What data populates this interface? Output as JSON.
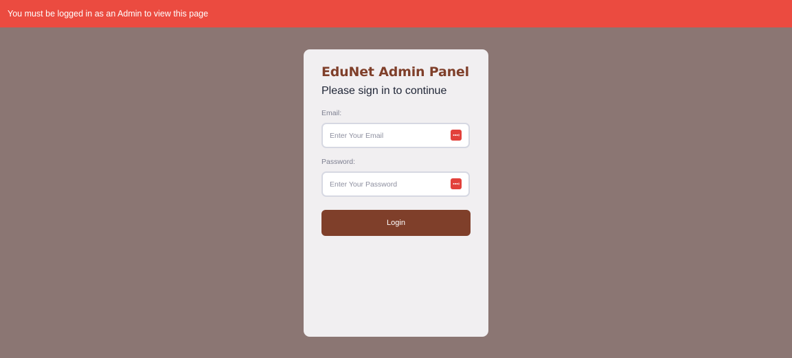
{
  "alert": {
    "message": "You must be logged in as an Admin to view this page",
    "color": "#eb4b40"
  },
  "login_card": {
    "title": "EduNet Admin Panel",
    "subtitle": "Please sign in to continue",
    "email": {
      "label": "Email:",
      "placeholder": "Enter Your Email",
      "value": "",
      "icon": "password-manager-icon"
    },
    "password": {
      "label": "Password:",
      "placeholder": "Enter Your Password",
      "value": "",
      "icon": "password-manager-icon"
    },
    "login_button_label": "Login"
  },
  "colors": {
    "page_background": "#8b7673",
    "card_background": "#f1eff1",
    "brand": "#7f3f2a",
    "icon_red": "#e2413b"
  }
}
